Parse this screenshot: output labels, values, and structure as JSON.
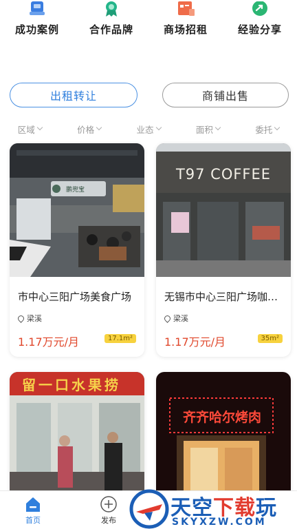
{
  "categories": [
    {
      "label": "成功案例",
      "icon": "case-icon",
      "color": "#3a7de0"
    },
    {
      "label": "合作品牌",
      "icon": "badge-icon",
      "color": "#23b58a"
    },
    {
      "label": "商场招租",
      "icon": "store-icon",
      "color": "#ef6c4a"
    },
    {
      "label": "经验分享",
      "icon": "share-icon",
      "color": "#2bb673"
    }
  ],
  "buttons": {
    "rent_label": "出租转让",
    "sell_label": "商铺出售"
  },
  "filters": [
    "区域",
    "价格",
    "业态",
    "面积",
    "委托"
  ],
  "listings": [
    {
      "title": "市中心三阳广场美食广场",
      "location": "梁溪",
      "price": "1.17万元/月",
      "area": "17.1m²",
      "image_text": "鹏兜宝"
    },
    {
      "title": "无锡市中心三阳广场咖啡店",
      "location": "梁溪",
      "price": "1.17万元/月",
      "area": "35m²",
      "image_text": "T97 COFFEE"
    },
    {
      "title": "",
      "location": "",
      "price": "",
      "area": "",
      "image_text": "留一口水果捞"
    },
    {
      "title": "",
      "location": "",
      "price": "",
      "area": "",
      "image_text": "齐齐哈尔烤肉"
    }
  ],
  "tabbar": {
    "home_label": "首页",
    "post_label": "发布"
  },
  "watermark": {
    "main_blue": "天空",
    "main_red": "下载",
    "main_end": "玩",
    "sub": "SKYXZW.COM"
  },
  "colors": {
    "accent": "#2f7fdd",
    "price": "#e0472b",
    "area_badge": "#f7d23e"
  }
}
